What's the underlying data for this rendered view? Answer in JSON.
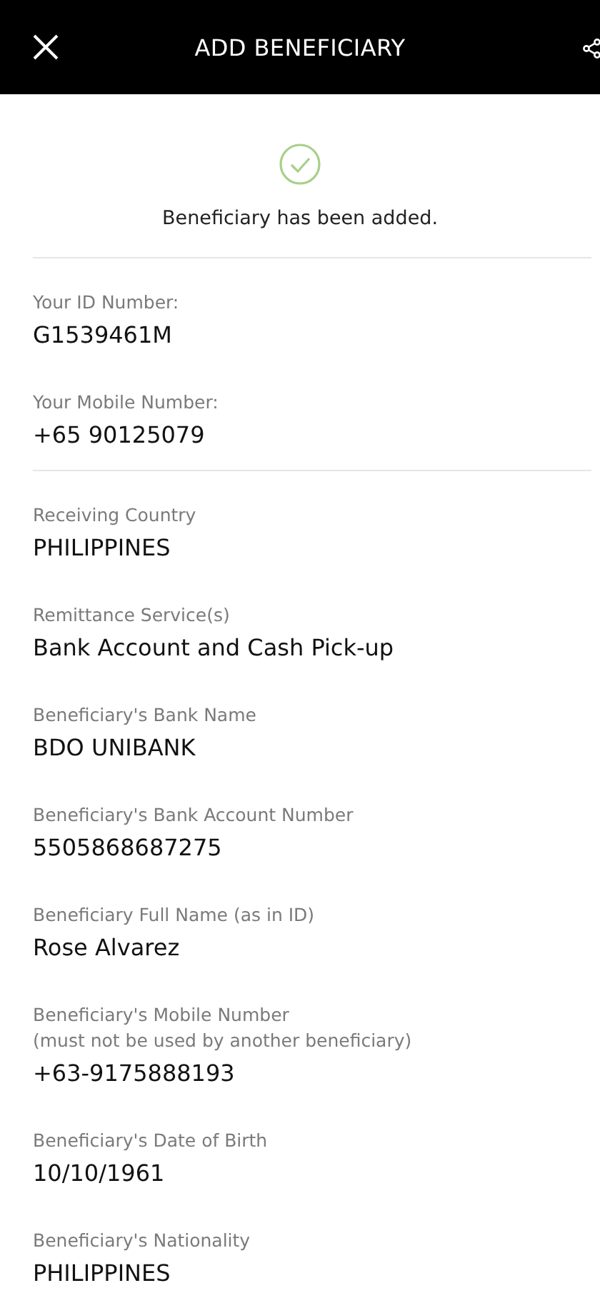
{
  "header": {
    "title": "ADD BENEFICIARY"
  },
  "status": {
    "message": "Beneficiary has been added."
  },
  "sections": [
    {
      "fields": [
        {
          "label": "Your ID Number:",
          "value": "G1539461M"
        },
        {
          "label": "Your Mobile Number:",
          "value": "+65 90125079"
        }
      ]
    },
    {
      "fields": [
        {
          "label": "Receiving Country",
          "value": "PHILIPPINES"
        },
        {
          "label": "Remittance Service(s)",
          "value": "Bank Account and Cash Pick-up"
        },
        {
          "label": "Beneficiary's Bank Name",
          "value": "BDO UNIBANK"
        },
        {
          "label": "Beneficiary's Bank Account Number",
          "value": "5505868687275"
        },
        {
          "label": "Beneficiary Full Name (as in ID)",
          "value": "Rose Alvarez"
        },
        {
          "label": "Beneficiary's Mobile Number",
          "note": "(must not be used by another beneficiary)",
          "value": "+63-9175888193"
        },
        {
          "label": "Beneficiary's Date of Birth",
          "value": "10/10/1961"
        },
        {
          "label": "Beneficiary's Nationality",
          "value": "PHILIPPINES"
        }
      ]
    }
  ]
}
